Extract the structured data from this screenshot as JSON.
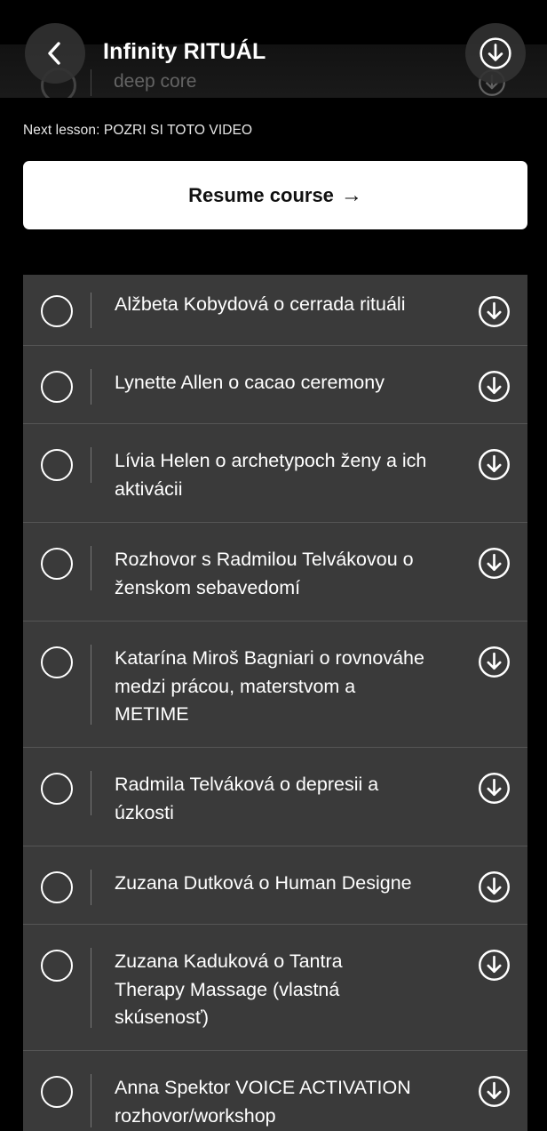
{
  "header": {
    "title": "Infinity RITUÁL",
    "back_icon": "chevron-left-icon",
    "download_icon": "download-icon",
    "ghost_row_text": "deep core"
  },
  "next_lesson": {
    "text": "Next lesson: POZRI SI TOTO VIDEO"
  },
  "resume": {
    "label": "Resume course",
    "arrow": "→"
  },
  "lessons": [
    {
      "title": "Alžbeta Kobydová o cerrada rituáli",
      "completed": false
    },
    {
      "title": "Lynette Allen o cacao ceremony",
      "completed": false
    },
    {
      "title": "Lívia Helen o archetypoch ženy a ich aktivácii",
      "completed": false
    },
    {
      "title": "Rozhovor s Radmilou Telvákovou o ženskom sebavedomí",
      "completed": false
    },
    {
      "title": "Katarína Miroš Bagniari o rovnováhe medzi prácou, materstvom a METIME",
      "completed": false
    },
    {
      "title": "Radmila Telváková o depresii a úzkosti",
      "completed": false
    },
    {
      "title": "Zuzana Dutková o Human Designe",
      "completed": false
    },
    {
      "title": "Zuzana Kaduková o Tantra Therapy Massage (vlastná skúsenosť)",
      "completed": false
    },
    {
      "title": "Anna Spektor VOICE ACTIVATION rozhovor/workshop",
      "completed": false
    }
  ],
  "colors": {
    "background": "#000000",
    "list_background": "#3a3a3a",
    "row_separator": "#555555",
    "resume_button": "#ffffff"
  }
}
